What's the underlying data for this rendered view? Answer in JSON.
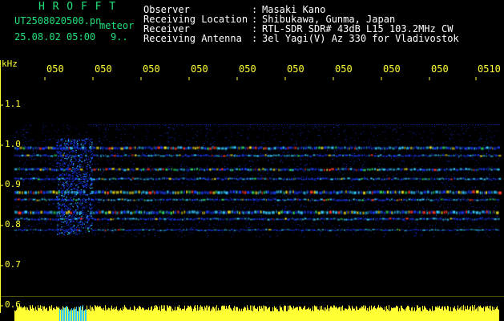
{
  "header": {
    "brand": "H R O F F T",
    "filename": "UT2508020500.pn",
    "meteor_label": "meteor",
    "datetime": "25.08.02 05:00",
    "count": "9..",
    "info": [
      {
        "label": "Observer",
        "value": "Masaki Kano"
      },
      {
        "label": "Receiving Location",
        "value": "Shibukawa, Gunma, Japan"
      },
      {
        "label": "Receiver",
        "value": "RTL-SDR SDR# 43dB L15 103.2MHz CW"
      },
      {
        "label": "Receiving Antenna",
        "value": "3el Yagi(V) Az 330 for Vladivostok"
      }
    ]
  },
  "axis": {
    "unit": "kHz",
    "y_ticks": [
      "1.1",
      "1.0",
      "0.9",
      "0.8",
      "0.7",
      "0.6"
    ],
    "x_ticks": [
      "050",
      "050",
      "050",
      "050",
      "050",
      "050",
      "050",
      "050",
      "050",
      "0510"
    ]
  },
  "colors": {
    "header_green": "#22e07a",
    "axis_yellow": "#ffff33",
    "signal_blue": "#1a3cff"
  }
}
